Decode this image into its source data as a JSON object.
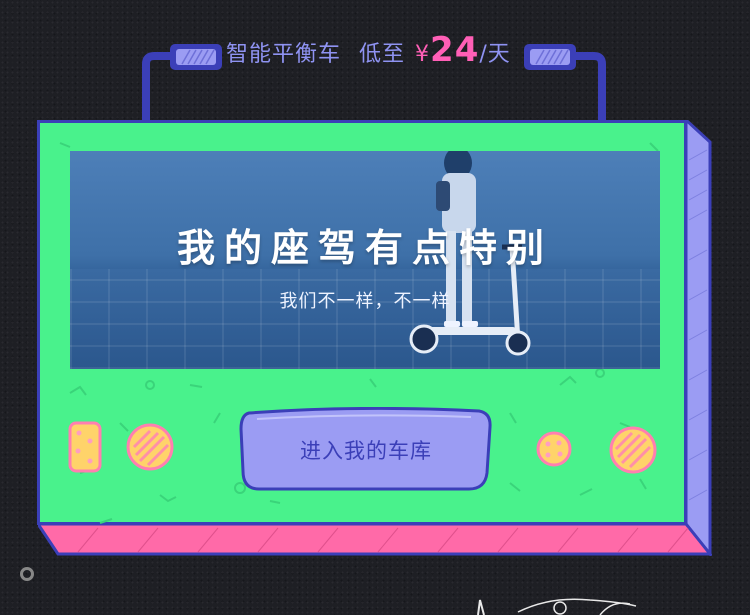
{
  "banner": {
    "product": "智能平衡车",
    "prefix": "低至",
    "currency": "¥",
    "price": "24",
    "unit": "/天"
  },
  "hero": {
    "title": "我的座驾有点特别",
    "subtitle": "我们不一样，不一样"
  },
  "cta": {
    "label": "进入我的车库"
  },
  "colors": {
    "background": "#1e1f24",
    "card_green": "#49f28c",
    "outline_blue": "#3b3fb8",
    "button_purple": "#9b9cf3",
    "price_pink": "#ff5fb6",
    "base_pink": "#ff6aa8"
  }
}
